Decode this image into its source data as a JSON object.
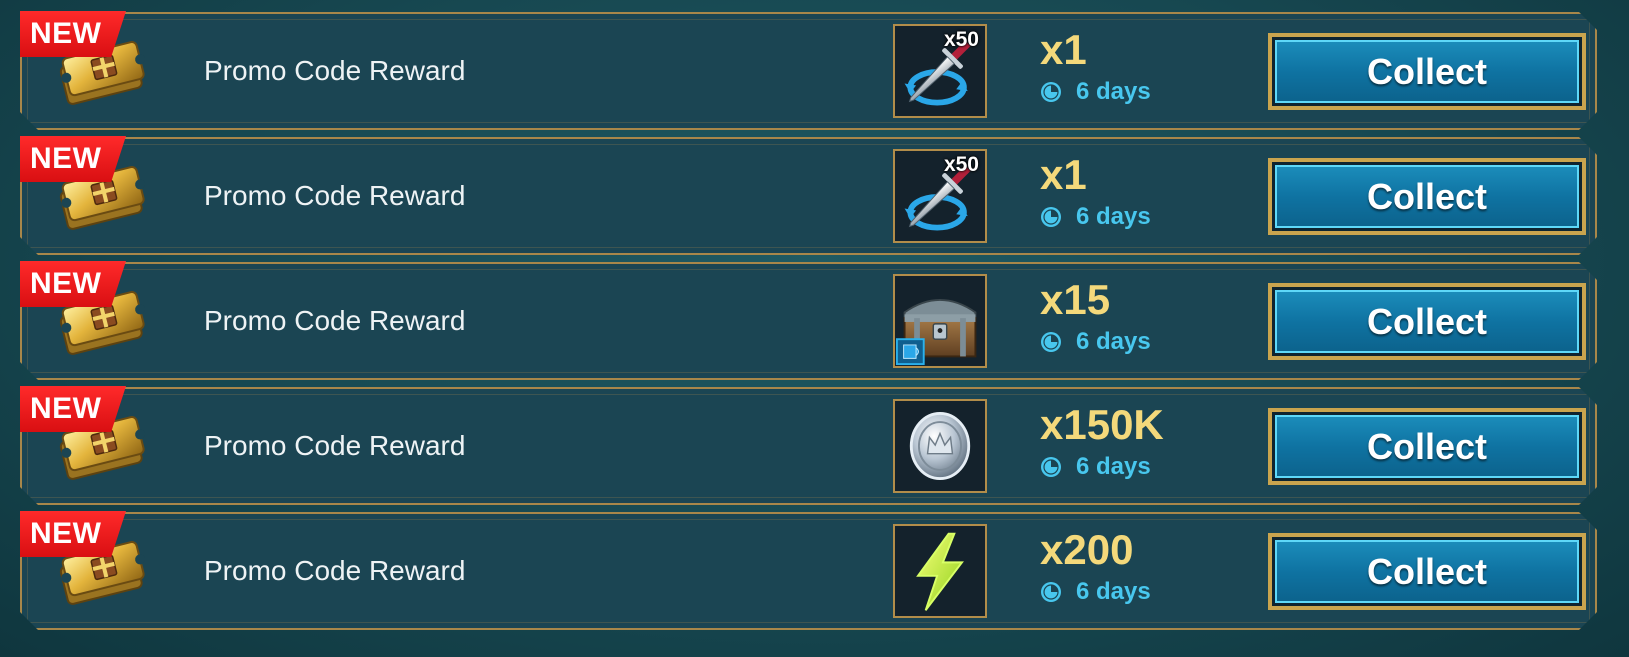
{
  "colors": {
    "background": "#174851",
    "row_background": "#1b4553",
    "row_border": "#a8874a",
    "new_badge": "#e3161a",
    "quantity_text": "#f4d97b",
    "timer_text": "#48c7ee",
    "button_fill": "#127ead",
    "button_border": "#c9a44e"
  },
  "rewards": [
    {
      "badge": "NEW",
      "label": "Promo Code Reward",
      "item_icon": "dagger-swap-icon",
      "item_count_overlay": "x50",
      "quantity": "x1",
      "expires": "6 days",
      "button": "Collect"
    },
    {
      "badge": "NEW",
      "label": "Promo Code Reward",
      "item_icon": "dagger-swap-icon",
      "item_count_overlay": "x50",
      "quantity": "x1",
      "expires": "6 days",
      "button": "Collect"
    },
    {
      "badge": "NEW",
      "label": "Promo Code Reward",
      "item_icon": "treasure-chest-icon",
      "item_count_overlay": "",
      "quantity": "x15",
      "expires": "6 days",
      "button": "Collect"
    },
    {
      "badge": "NEW",
      "label": "Promo Code Reward",
      "item_icon": "silver-coin-icon",
      "item_count_overlay": "",
      "quantity": "x150K",
      "expires": "6 days",
      "button": "Collect"
    },
    {
      "badge": "NEW",
      "label": "Promo Code Reward",
      "item_icon": "energy-bolt-icon",
      "item_count_overlay": "",
      "quantity": "x200",
      "expires": "6 days",
      "button": "Collect"
    }
  ]
}
